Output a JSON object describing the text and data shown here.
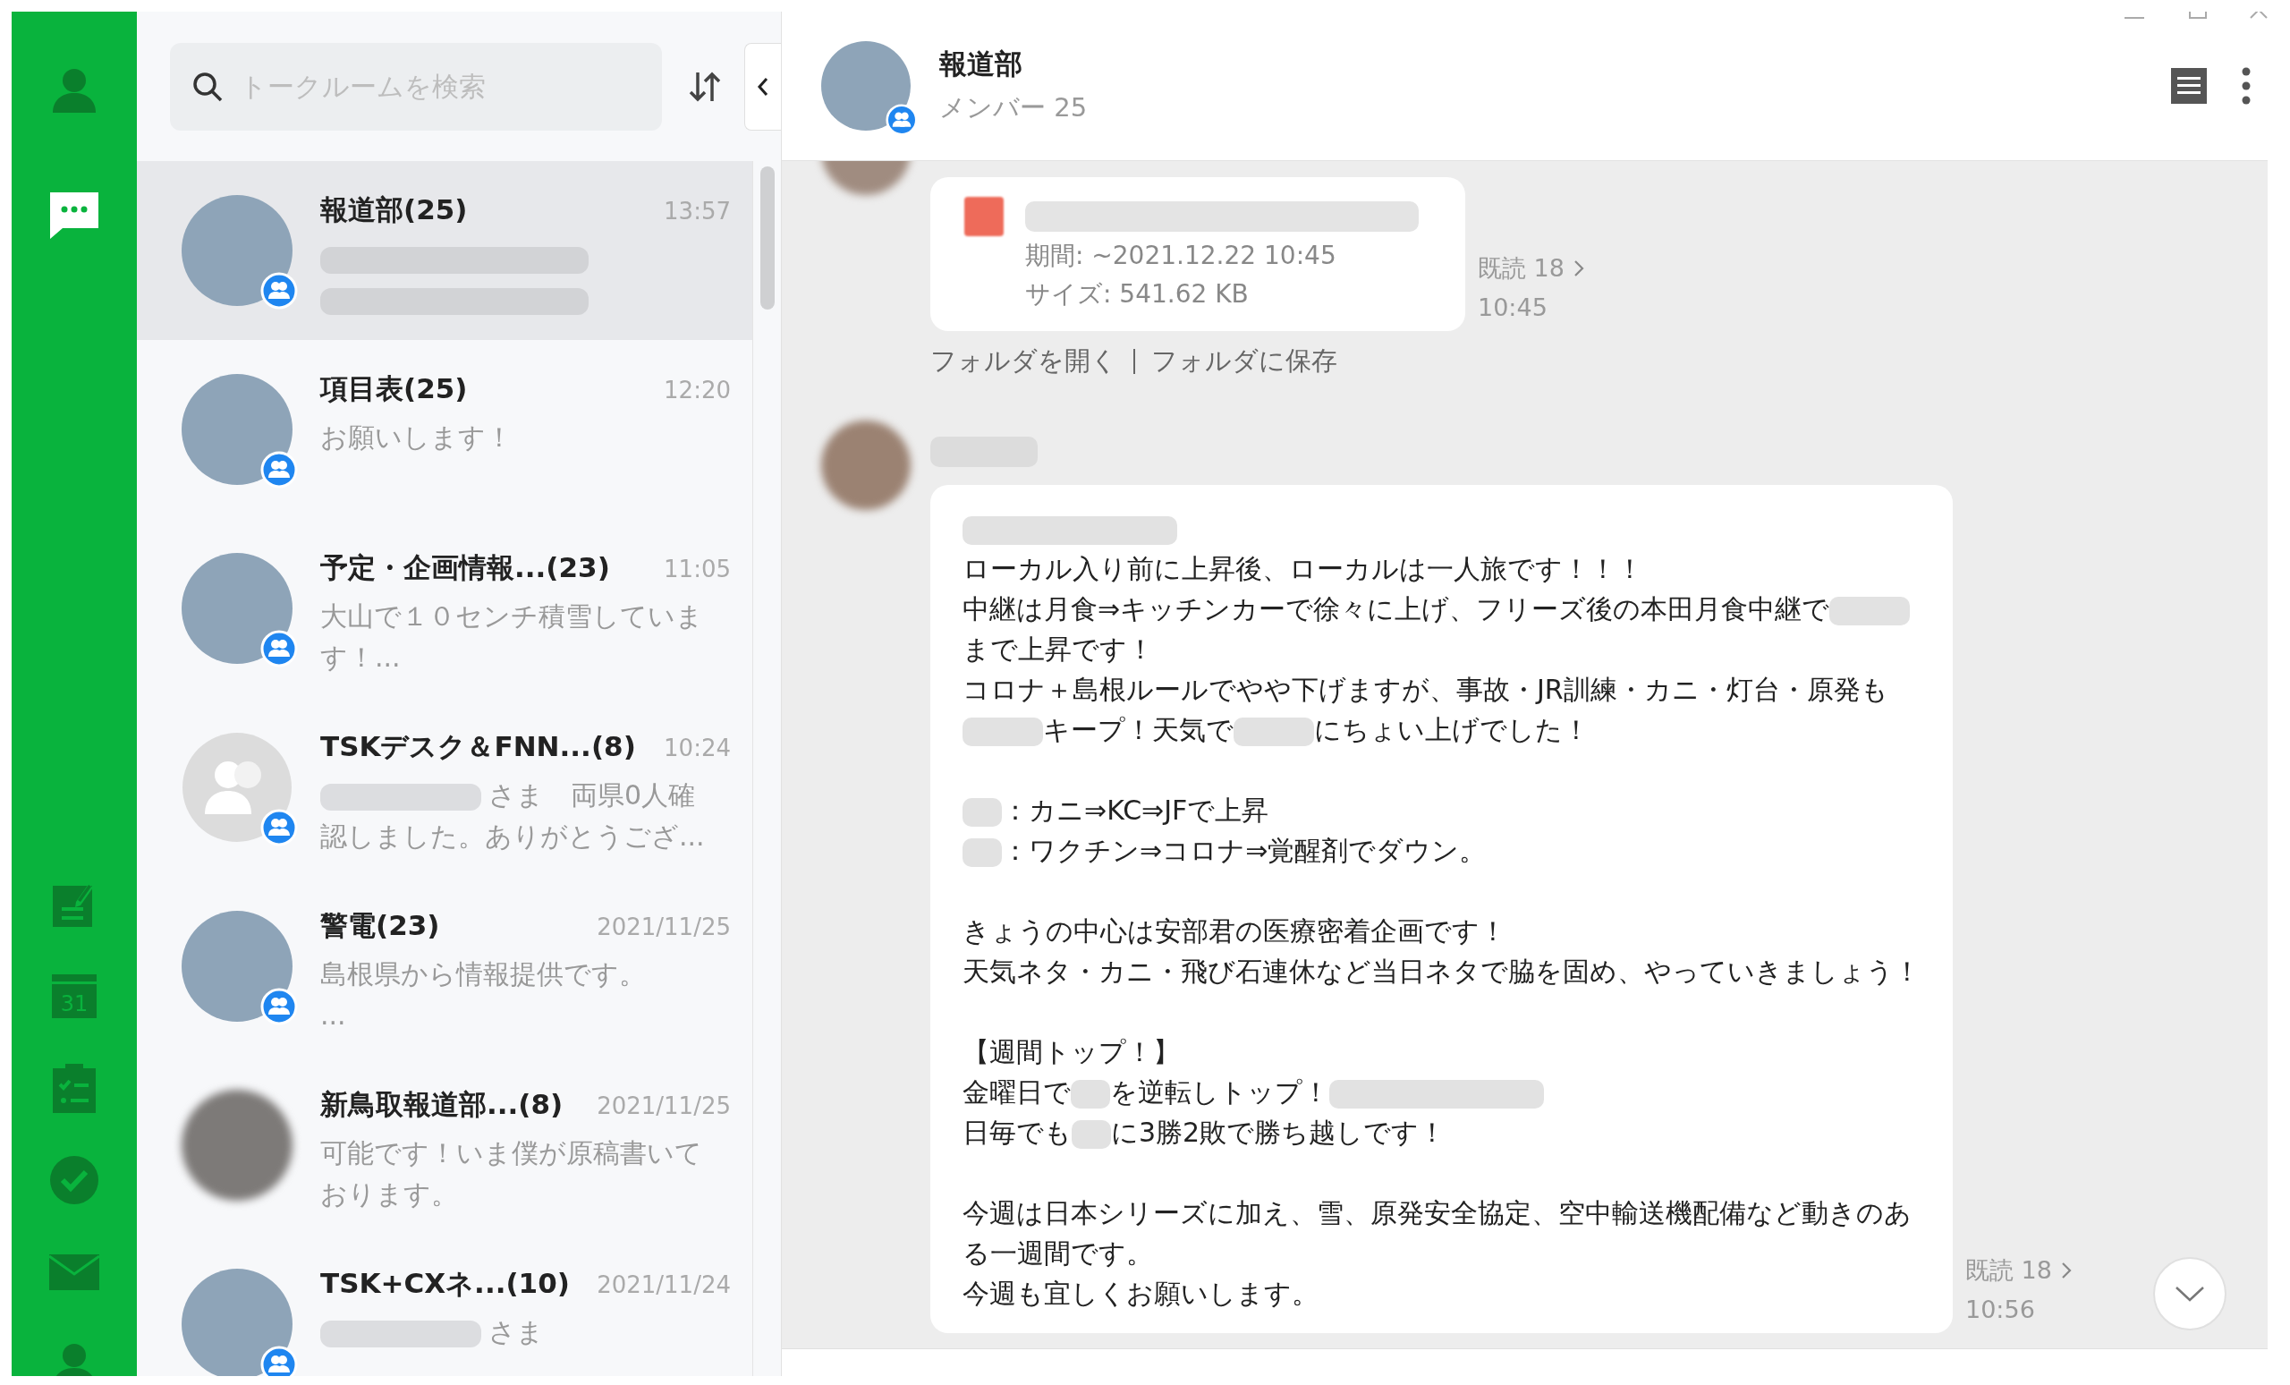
{
  "sidebar": {
    "top_items": [
      {
        "kind": "profile",
        "selected": false
      },
      {
        "kind": "chats",
        "selected": true
      }
    ],
    "bottom_items": [
      {
        "kind": "notes",
        "selected": false
      },
      {
        "kind": "calendar",
        "label": "31",
        "selected": false
      },
      {
        "kind": "tasks",
        "selected": false
      },
      {
        "kind": "check",
        "selected": false
      },
      {
        "kind": "mail",
        "selected": false
      },
      {
        "kind": "profile",
        "selected": false
      }
    ]
  },
  "chat_list": {
    "search": {
      "placeholder": "トークルームを検索"
    },
    "chats": [
      {
        "name": "報道部(25)",
        "time": "13:57",
        "kind": "photo",
        "group": true,
        "selected": true,
        "preview": [
          [
            {
              "kind": "redacted_long"
            }
          ],
          [
            {
              "kind": "redacted_long"
            }
          ]
        ]
      },
      {
        "name": "項目表(25)",
        "time": "12:20",
        "kind": "photo",
        "group": true,
        "selected": false,
        "preview": [
          [
            {
              "kind": "text",
              "text": "お願いします！"
            }
          ]
        ]
      },
      {
        "name": "予定・企画情報...(23)",
        "time": "11:05",
        "kind": "photo",
        "group": true,
        "selected": false,
        "preview": [
          [
            {
              "kind": "text",
              "text": "大山で１０センチ積雪していま"
            }
          ],
          [
            {
              "kind": "text",
              "text": "す！..."
            }
          ]
        ]
      },
      {
        "name": "TSKデスク＆FNN...(8)",
        "time": "10:24",
        "kind": "default",
        "group": true,
        "selected": false,
        "preview": [
          [
            {
              "kind": "redacted"
            },
            {
              "kind": "text",
              "text": "さま　両県0人確"
            }
          ],
          [
            {
              "kind": "text",
              "text": "認しました。ありがとうござ..."
            }
          ]
        ]
      },
      {
        "name": "警電(23)",
        "time": "2021/11/25",
        "kind": "photo",
        "group": true,
        "selected": false,
        "preview": [
          [
            {
              "kind": "text",
              "text": "島根県から情報提供です。"
            }
          ],
          [
            {
              "kind": "text",
              "text": "..."
            }
          ]
        ]
      },
      {
        "name": "新鳥取報道部...(8)",
        "time": "2021/11/25",
        "kind": "photo",
        "group": false,
        "selected": false,
        "preview": [
          [
            {
              "kind": "text",
              "text": "可能です！いま僕が原稿書いて"
            }
          ],
          [
            {
              "kind": "text",
              "text": "おります。"
            }
          ]
        ]
      },
      {
        "name": "TSK+CXネ...(10)",
        "time": "2021/11/24",
        "kind": "photo",
        "group": true,
        "selected": false,
        "preview": [
          [
            {
              "kind": "redacted"
            },
            {
              "kind": "text",
              "text": "さま"
            }
          ]
        ]
      }
    ]
  },
  "chat": {
    "title": "報道部",
    "subtitle": "メンバー 25",
    "messages": [
      {
        "kind": "file",
        "details": [
          "期間: ~2021.12.22 10:45",
          "サイズ: 541.62 KB"
        ],
        "read": "既読 18",
        "time": "10:45",
        "actions": [
          "フォルダを開く",
          "フォルダに保存"
        ]
      },
      {
        "kind": "text",
        "read": "既読 18",
        "time": "10:56",
        "paragraphs": [
          [
            [
              {
                "kind": "redacted_long"
              }
            ],
            [
              {
                "kind": "text",
                "text": "ローカル入り前に上昇後、ローカルは一人旅です！！！"
              }
            ],
            [
              {
                "kind": "text",
                "text": "中継は月食⇒キッチンカーで徐々に上げ、フリーズ後の本田月食中継で"
              },
              {
                "kind": "redacted"
              }
            ],
            [
              {
                "kind": "text",
                "text": "まで上昇です！"
              }
            ],
            [
              {
                "kind": "text",
                "text": "コロナ＋島根ルールでやや下げますが、事故・JR訓練・カニ・灯台・原発も"
              }
            ],
            [
              {
                "kind": "redacted"
              },
              {
                "kind": "text",
                "text": "キープ！天気で"
              },
              {
                "kind": "redacted"
              },
              {
                "kind": "text",
                "text": "にちょい上げでした！"
              }
            ]
          ],
          [
            [
              {
                "kind": "redacted_short"
              },
              {
                "kind": "text",
                "text": "：カニ⇒KC⇒JFで上昇"
              }
            ],
            [
              {
                "kind": "redacted_short"
              },
              {
                "kind": "text",
                "text": "：ワクチン⇒コロナ⇒覚醒剤でダウン。"
              }
            ]
          ],
          [
            [
              {
                "kind": "text",
                "text": "きょうの中心は安部君の医療密着企画です！"
              }
            ],
            [
              {
                "kind": "text",
                "text": "天気ネタ・カニ・飛び石連休など当日ネタで脇を固め、やっていきましょう！"
              }
            ]
          ],
          [
            [
              {
                "kind": "text",
                "text": "【週間トップ！】"
              }
            ],
            [
              {
                "kind": "text",
                "text": "金曜日で"
              },
              {
                "kind": "redacted_short"
              },
              {
                "kind": "text",
                "text": "を逆転しトップ！"
              },
              {
                "kind": "redacted_long"
              }
            ],
            [
              {
                "kind": "text",
                "text": "日毎でも"
              },
              {
                "kind": "redacted_short"
              },
              {
                "kind": "text",
                "text": "に3勝2敗で勝ち越しです！"
              }
            ]
          ],
          [
            [
              {
                "kind": "text",
                "text": "今週は日本シリーズに加え、雪、原発安全協定、空中輸送機配備など動きのあ"
              }
            ],
            [
              {
                "kind": "text",
                "text": "る一週間です。"
              }
            ],
            [
              {
                "kind": "text",
                "text": "今週も宜しくお願いします。"
              }
            ]
          ]
        ]
      }
    ]
  }
}
